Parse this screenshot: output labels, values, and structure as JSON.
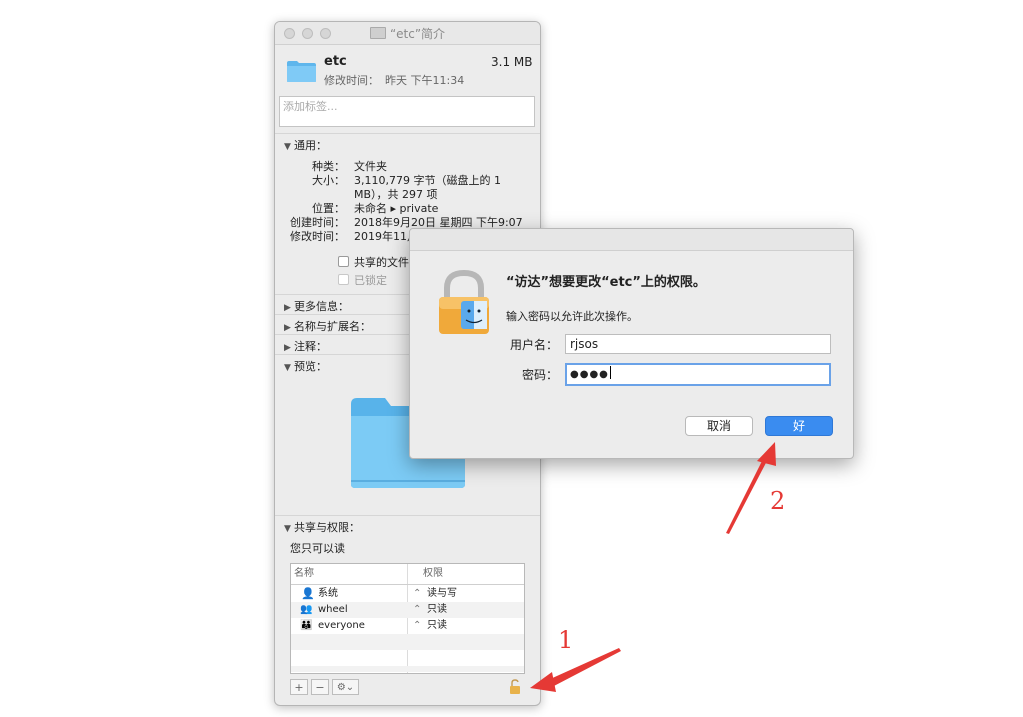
{
  "info_window": {
    "title": "“etc”简介",
    "name": "etc",
    "size": "3.1 MB",
    "modified_label": "修改时间：",
    "modified_value": "昨天 下午11:34",
    "tags_placeholder": "添加标签...",
    "general": {
      "header": "通用：",
      "kind_label": "种类：",
      "kind_value": "文件夹",
      "size_label": "大小：",
      "size_value_line1": "3,110,779 字节（磁盘上的 1",
      "size_value_line2": "MB），共 297 项",
      "where_label": "位置：",
      "where_value": "未命名 ▸ private",
      "created_label": "创建时间：",
      "created_value": "2018年9月20日 星期四 下午9:07",
      "modified_label": "修改时间：",
      "modified_value": "2019年11月",
      "shared_folder": "共享的文件",
      "locked": "已锁定"
    },
    "more_info": "更多信息：",
    "name_ext": "名称与扩展名：",
    "comments": "注释：",
    "preview": "预览：",
    "sharing": {
      "header": "共享与权限：",
      "status": "您只可以读",
      "col_name": "名称",
      "col_priv": "权限",
      "rows": [
        {
          "name": "系统",
          "priv": "读与写",
          "icon": "single-user-icon"
        },
        {
          "name": "wheel",
          "priv": "只读",
          "icon": "group-icon"
        },
        {
          "name": "everyone",
          "priv": "只读",
          "icon": "everyone-icon"
        }
      ]
    },
    "toolbar": {
      "add": "+",
      "remove": "−",
      "gear": "⚙︎⌄"
    }
  },
  "dialog": {
    "message": "“访达”想要更改“etc”上的权限。",
    "info": "输入密码以允许此次操作。",
    "username_label": "用户名：",
    "username_value": "rjsos",
    "password_label": "密码：",
    "password_value": "●●●●",
    "cancel": "取消",
    "ok": "好"
  },
  "annotations": {
    "num1": "1",
    "num2": "2",
    "color": "#e53935"
  },
  "colors": {
    "accent": "#3a8cf0",
    "folder": "#6ec3f4"
  }
}
